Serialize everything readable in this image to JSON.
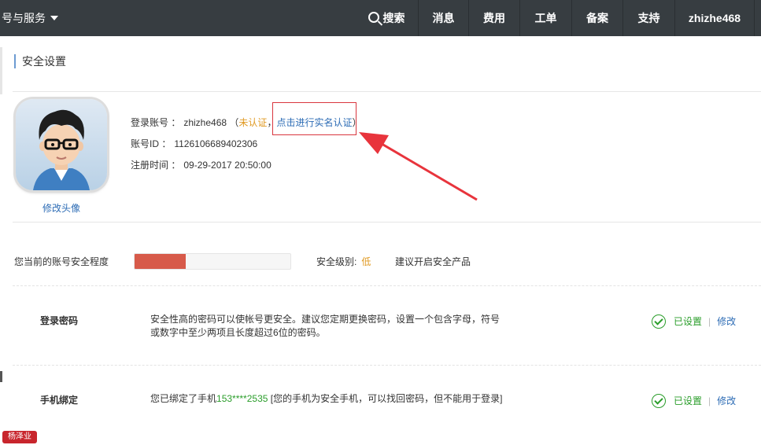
{
  "topbar": {
    "left_menu": "号与服务",
    "search": "搜索",
    "items": [
      "消息",
      "费用",
      "工单",
      "备案",
      "支持"
    ],
    "user": "zhizhe468"
  },
  "page_title": "安全设置",
  "profile": {
    "avatar_edit": "修改头像",
    "login_account_label": "登录账号 ：",
    "login_account_value": "zhizhe468",
    "paren_open": "（",
    "unverified": "未认证",
    "comma": "，",
    "verify_link": "点击进行实名认证",
    "paren_close": "）",
    "account_id_label": "账号ID ：",
    "account_id_value": "1126106689402306",
    "register_time_label": "注册时间 ：",
    "register_time_value": "09-29-2017 20:50:00"
  },
  "security": {
    "label": "您当前的账号安全程度",
    "level_fraction": 0.33,
    "level_label": "安全级别:",
    "level_value": "低",
    "suggest": "建议开启安全产品"
  },
  "rows": [
    {
      "title": "登录密码",
      "desc": "安全性高的密码可以使帐号更安全。建议您定期更换密码，设置一个包含字母，符号或数字中至少两项且长度超过6位的密码。",
      "status": "已设置",
      "action": "修改"
    },
    {
      "title": "手机绑定",
      "desc_prefix": "您已绑定了手机",
      "phone": "153****2535",
      "desc_suffix": " [您的手机为安全手机，可以找回密码，但不能用于登录]",
      "status": "已设置",
      "action": "修改"
    }
  ],
  "watermark": "杨泽业",
  "colors": {
    "topbar": "#373d41",
    "link": "#2d6cb5",
    "warning": "#e09a23",
    "success": "#2a9d2a",
    "danger": "#d75a4a",
    "annotation": "#e8343c"
  }
}
